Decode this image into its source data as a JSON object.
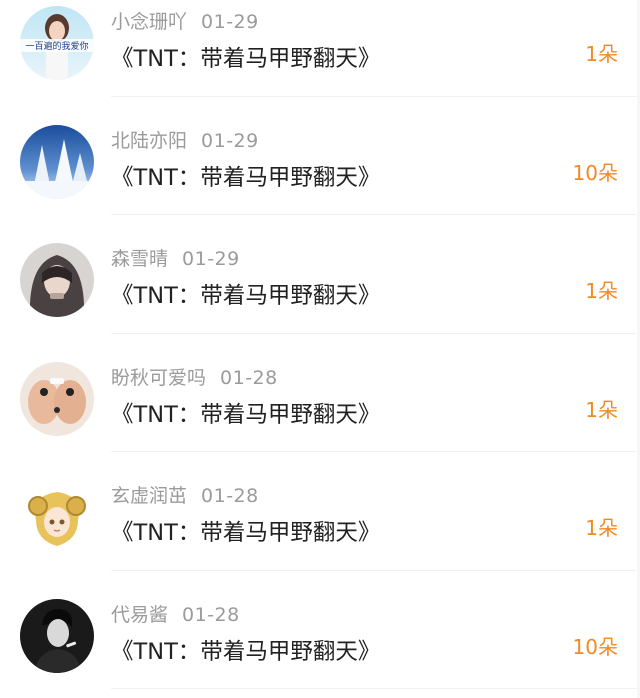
{
  "items": [
    {
      "user": "小念珊吖",
      "date": "01-29",
      "title": "《TNT：带着马甲野翻天》",
      "gift": "1朵",
      "avatar_caption": "一百遍的我爱你",
      "avatar_icon": "girl-photo-avatar"
    },
    {
      "user": "北陆亦阳",
      "date": "01-29",
      "title": "《TNT：带着马甲野翻天》",
      "gift": "10朵",
      "avatar_icon": "snowy-trees-avatar"
    },
    {
      "user": "森雪晴",
      "date": "01-29",
      "title": "《TNT：带着马甲野翻天》",
      "gift": "1朵",
      "avatar_icon": "hooded-girl-avatar"
    },
    {
      "user": "盼秋可爱吗",
      "date": "01-28",
      "title": "《TNT：带着马甲野翻天》",
      "gift": "1朵",
      "avatar_icon": "hands-rings-avatar"
    },
    {
      "user": "玄虚润茁",
      "date": "01-28",
      "title": "《TNT：带着马甲野翻天》",
      "gift": "1朵",
      "avatar_icon": "anime-girl-avatar"
    },
    {
      "user": "代易酱",
      "date": "01-28",
      "title": "《TNT：带着马甲野翻天》",
      "gift": "10朵",
      "avatar_icon": "man-portrait-avatar"
    }
  ],
  "colors": {
    "gift": "#f08a24",
    "meta": "#9b9b9b",
    "title": "#222222"
  }
}
